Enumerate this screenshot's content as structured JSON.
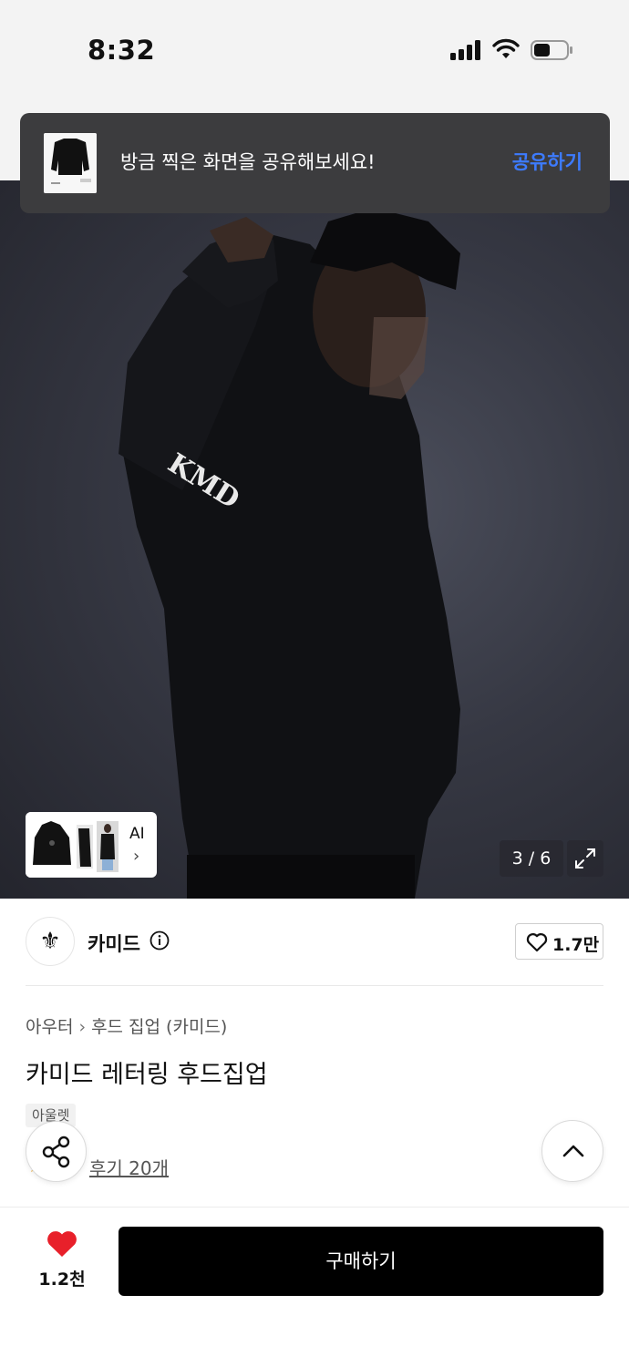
{
  "status_bar": {
    "time": "8:32"
  },
  "toast": {
    "message": "방금 찍은 화면을 공유해보세요!",
    "action": "공유하기"
  },
  "gallery": {
    "ai_label": "AI",
    "ai_chevron": "›",
    "counter": "3 / 6"
  },
  "brand": {
    "logo_glyph": "⚜",
    "name": "카미드",
    "likes": "1.7만"
  },
  "breadcrumb": {
    "category": "아우터",
    "separator": "›",
    "subcategory": "후드 집업 (카미드)"
  },
  "product": {
    "title": "카미드 레터링 후드집업",
    "tag": "아울렛",
    "review_star": "★",
    "reviews": "후기 20개"
  },
  "bottom_bar": {
    "wish_count": "1.2천",
    "buy_label": "구매하기"
  },
  "colors": {
    "accent": "#3d7bff",
    "heart": "#e8202a",
    "buy_bg": "#000000",
    "toast_bg": "#3c3c3e"
  },
  "icons": [
    "signal-icon",
    "wifi-icon",
    "battery-icon",
    "expand-icon",
    "info-icon",
    "heart-outline-icon",
    "share-icon",
    "chevron-up-icon",
    "heart-filled-icon"
  ]
}
